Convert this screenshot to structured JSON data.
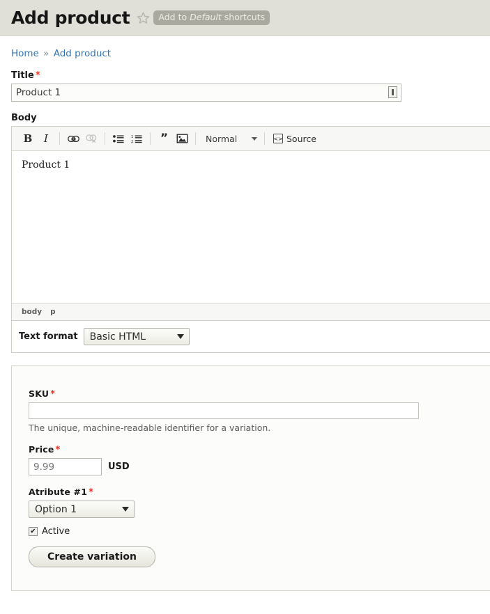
{
  "header": {
    "title": "Add product",
    "star_icon": "star-outline-icon",
    "shortcut_prefix": "Add to",
    "shortcut_emphasis": "Default",
    "shortcut_suffix": "shortcuts"
  },
  "breadcrumb": {
    "home": "Home",
    "separator": "»",
    "current": "Add product"
  },
  "title_field": {
    "label": "Title",
    "required_mark": "*",
    "value": "Product 1",
    "machine_icon": "machine-name-icon"
  },
  "body_field": {
    "label": "Body",
    "editor": {
      "toolbar": {
        "bold": "B",
        "italic": "I",
        "link": "link-icon",
        "unlink": "unlink-icon",
        "bulleted_list": "bulleted-list-icon",
        "numbered_list": "numbered-list-icon",
        "blockquote": "”",
        "image": "image-icon",
        "paragraph_format": "Normal",
        "source_label": "Source",
        "source_icon": "source-code-icon"
      },
      "content": "Product 1",
      "element_path": [
        "body",
        "p"
      ]
    },
    "text_format": {
      "label": "Text format",
      "selected": "Basic HTML",
      "options": [
        "Basic HTML"
      ]
    }
  },
  "variation": {
    "sku": {
      "label": "SKU",
      "required_mark": "*",
      "value": "",
      "description": "The unique, machine-readable identifier for a variation."
    },
    "price": {
      "label": "Price",
      "required_mark": "*",
      "placeholder": "9.99",
      "value": "",
      "currency": "USD"
    },
    "attribute": {
      "label": "Atribute #1",
      "required_mark": "*",
      "selected": "Option 1",
      "options": [
        "Option 1"
      ]
    },
    "active": {
      "label": "Active",
      "checked": true,
      "check_glyph": "✔"
    },
    "submit_label": "Create variation"
  },
  "colors": {
    "header_bg": "#e0e0d8",
    "link": "#3476b5",
    "required": "#ee3322",
    "pill_bg": "#a9a9a0"
  }
}
